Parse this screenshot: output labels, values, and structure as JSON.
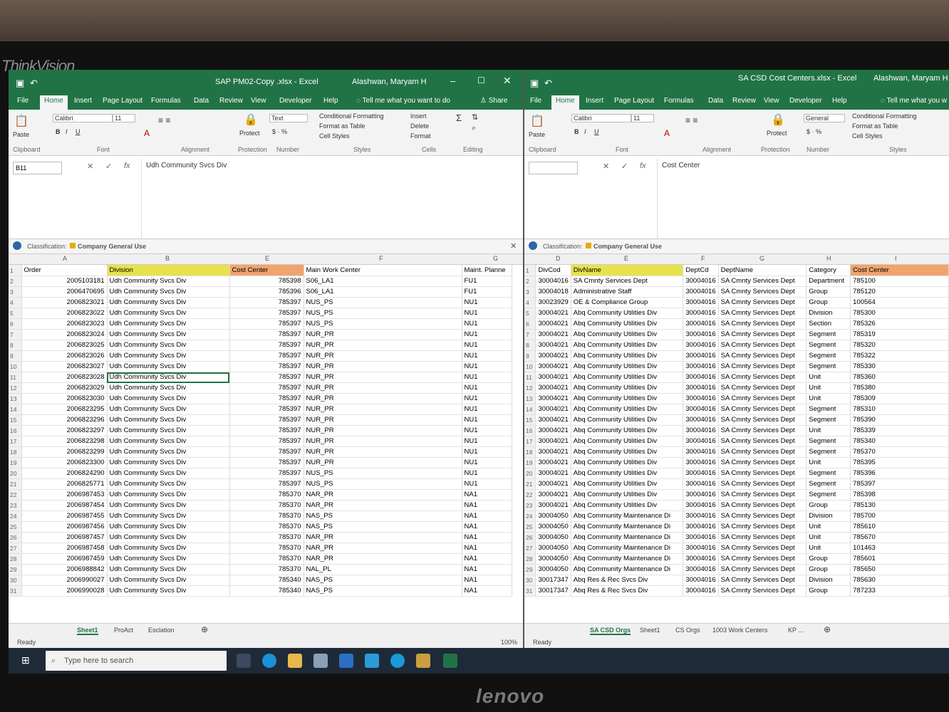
{
  "monitor": {
    "brand_top": "ThinkVision",
    "brand_bottom": "lenovo"
  },
  "left": {
    "title": "SAP PM02-Copy .xlsx - Excel",
    "user": "Alashwan, Maryam H",
    "tabs": [
      "File",
      "Home",
      "Insert",
      "Page Layout",
      "Formulas",
      "Data",
      "Review",
      "View",
      "Developer",
      "Help"
    ],
    "tell_me": "Tell me what you want to do",
    "share": "Share",
    "ribbon": {
      "font": "Calibri",
      "size": "11",
      "number_format": "Text",
      "cond_fmt": "Conditional Formatting",
      "fmt_table": "Format as Table",
      "cell_styles": "Cell Styles",
      "insert": "Insert",
      "delete": "Delete",
      "format": "Format",
      "protect": "Protect",
      "paste": "Paste",
      "groups": [
        "Clipboard",
        "Font",
        "Alignment",
        "Protection",
        "Number",
        "Styles",
        "Cells",
        "Editing"
      ]
    },
    "name_box": "B11",
    "formula": "Udh Community Svcs Div",
    "classification_label": "Classification:",
    "classification_value": "Company General Use",
    "col_letters": [
      "A",
      "B",
      "E",
      "F",
      "G"
    ],
    "headers": [
      "Order",
      "Division",
      "Cost Center",
      "Main Work Center",
      "Maint. Planne"
    ],
    "rows": [
      [
        "2005103181",
        "Udh Community Svcs Div",
        "785398",
        "S06_LA1",
        "FU1"
      ],
      [
        "2006470695",
        "Udh Community Svcs Div",
        "785396",
        "S06_LA1",
        "FU1"
      ],
      [
        "2006823021",
        "Udh Community Svcs Div",
        "785397",
        "NUS_PS",
        "NU1"
      ],
      [
        "2006823022",
        "Udh Community Svcs Div",
        "785397",
        "NUS_PS",
        "NU1"
      ],
      [
        "2006823023",
        "Udh Community Svcs Div",
        "785397",
        "NUS_PS",
        "NU1"
      ],
      [
        "2006823024",
        "Udh Community Svcs Div",
        "785397",
        "NUR_PR",
        "NU1"
      ],
      [
        "2006823025",
        "Udh Community Svcs Div",
        "785397",
        "NUR_PR",
        "NU1"
      ],
      [
        "2006823026",
        "Udh Community Svcs Div",
        "785397",
        "NUR_PR",
        "NU1"
      ],
      [
        "2006823027",
        "Udh Community Svcs Div",
        "785397",
        "NUR_PR",
        "NU1"
      ],
      [
        "2006823028",
        "Udh Community Svcs Div",
        "785397",
        "NUR_PR",
        "NU1"
      ],
      [
        "2006823029",
        "Udh Community Svcs Div",
        "785397",
        "NUR_PR",
        "NU1"
      ],
      [
        "2006823030",
        "Udh Community Svcs Div",
        "785397",
        "NUR_PR",
        "NU1"
      ],
      [
        "2006823295",
        "Udh Community Svcs Div",
        "785397",
        "NUR_PR",
        "NU1"
      ],
      [
        "2006823296",
        "Udh Community Svcs Div",
        "785397",
        "NUR_PR",
        "NU1"
      ],
      [
        "2006823297",
        "Udh Community Svcs Div",
        "785397",
        "NUR_PR",
        "NU1"
      ],
      [
        "2006823298",
        "Udh Community Svcs Div",
        "785397",
        "NUR_PR",
        "NU1"
      ],
      [
        "2006823299",
        "Udh Community Svcs Div",
        "785397",
        "NUR_PR",
        "NU1"
      ],
      [
        "2006823300",
        "Udh Community Svcs Div",
        "785397",
        "NUR_PR",
        "NU1"
      ],
      [
        "2006824290",
        "Udh Community Svcs Div",
        "785397",
        "NUS_PS",
        "NU1"
      ],
      [
        "2006825771",
        "Udh Community Svcs Div",
        "785397",
        "NUS_PS",
        "NU1"
      ],
      [
        "2006987453",
        "Udh Community Svcs Div",
        "785370",
        "NAR_PR",
        "NA1"
      ],
      [
        "2006987454",
        "Udh Community Svcs Div",
        "785370",
        "NAR_PR",
        "NA1"
      ],
      [
        "2006987455",
        "Udh Community Svcs Div",
        "785370",
        "NAS_PS",
        "NA1"
      ],
      [
        "2006987456",
        "Udh Community Svcs Div",
        "785370",
        "NAS_PS",
        "NA1"
      ],
      [
        "2006987457",
        "Udh Community Svcs Div",
        "785370",
        "NAR_PR",
        "NA1"
      ],
      [
        "2006987458",
        "Udh Community Svcs Div",
        "785370",
        "NAR_PR",
        "NA1"
      ],
      [
        "2006987459",
        "Udh Community Svcs Div",
        "785370",
        "NAR_PR",
        "NA1"
      ],
      [
        "2006988842",
        "Udh Community Svcs Div",
        "785370",
        "NAL_PL",
        "NA1"
      ],
      [
        "2006990027",
        "Udh Community Svcs Div",
        "785340",
        "NAS_PS",
        "NA1"
      ],
      [
        "2006990028",
        "Udh Community Svcs Div",
        "785340",
        "NAS_PS",
        "NA1"
      ]
    ],
    "sheet_tabs": [
      "Sheet1",
      "ProAct",
      "Esclation"
    ],
    "status": "Ready",
    "zoom": "100%"
  },
  "right": {
    "title": "SA CSD Cost Centers.xlsx - Excel",
    "user": "Alashwan, Maryam H",
    "tabs": [
      "File",
      "Home",
      "Insert",
      "Page Layout",
      "Formulas",
      "Data",
      "Review",
      "View",
      "Developer",
      "Help"
    ],
    "tell_me": "Tell me what you w",
    "ribbon": {
      "font": "Calibri",
      "size": "11",
      "number_format": "General",
      "cond_fmt": "Conditional Formatting",
      "fmt_table": "Format as Table",
      "cell_styles": "Cell Styles",
      "protect": "Protect",
      "paste": "Paste",
      "groups": [
        "Clipboard",
        "Font",
        "Alignment",
        "Protection",
        "Number",
        "Styles"
      ]
    },
    "formula": "Cost Center",
    "classification_label": "Classification:",
    "classification_value": "Company General Use",
    "col_letters": [
      "D",
      "E",
      "F",
      "G",
      "H",
      "I"
    ],
    "headers": [
      "DivCod",
      "DivName",
      "DeptCd",
      "DeptName",
      "Category",
      "Cost Center"
    ],
    "rows": [
      [
        "30004016",
        "SA Cmnty Services Dept",
        "30004016",
        "SA Cmnty Services Dept",
        "Department",
        "785100"
      ],
      [
        "30004018",
        "Administrative Staff",
        "30004016",
        "SA Cmnty Services Dept",
        "Group",
        "785120"
      ],
      [
        "30023929",
        "OE & Compliance Group",
        "30004016",
        "SA Cmnty Services Dept",
        "Group",
        "100564"
      ],
      [
        "30004021",
        "Abq Community Utilities Div",
        "30004016",
        "SA Cmnty Services Dept",
        "Division",
        "785300"
      ],
      [
        "30004021",
        "Abq Community Utilities Div",
        "30004016",
        "SA Cmnty Services Dept",
        "Section",
        "785326"
      ],
      [
        "30004021",
        "Abq Community Utilities Div",
        "30004016",
        "SA Cmnty Services Dept",
        "Segment",
        "785319"
      ],
      [
        "30004021",
        "Abq Community Utilities Div",
        "30004016",
        "SA Cmnty Services Dept",
        "Segment",
        "785320"
      ],
      [
        "30004021",
        "Abq Community Utilities Div",
        "30004016",
        "SA Cmnty Services Dept",
        "Segment",
        "785322"
      ],
      [
        "30004021",
        "Abq Community Utilities Div",
        "30004016",
        "SA Cmnty Services Dept",
        "Segment",
        "785330"
      ],
      [
        "30004021",
        "Abq Community Utilities Div",
        "30004016",
        "SA Cmnty Services Dept",
        "Unit",
        "785360"
      ],
      [
        "30004021",
        "Abq Community Utilities Div",
        "30004016",
        "SA Cmnty Services Dept",
        "Unit",
        "785380"
      ],
      [
        "30004021",
        "Abq Community Utilities Div",
        "30004016",
        "SA Cmnty Services Dept",
        "Unit",
        "785309"
      ],
      [
        "30004021",
        "Abq Community Utilities Div",
        "30004016",
        "SA Cmnty Services Dept",
        "Segment",
        "785310"
      ],
      [
        "30004021",
        "Abq Community Utilities Div",
        "30004016",
        "SA Cmnty Services Dept",
        "Segment",
        "785390"
      ],
      [
        "30004021",
        "Abq Community Utilities Div",
        "30004016",
        "SA Cmnty Services Dept",
        "Unit",
        "785339"
      ],
      [
        "30004021",
        "Abq Community Utilities Div",
        "30004016",
        "SA Cmnty Services Dept",
        "Segment",
        "785340"
      ],
      [
        "30004021",
        "Abq Community Utilities Div",
        "30004016",
        "SA Cmnty Services Dept",
        "Segment",
        "785370"
      ],
      [
        "30004021",
        "Abq Community Utilities Div",
        "30004016",
        "SA Cmnty Services Dept",
        "Unit",
        "785395"
      ],
      [
        "30004021",
        "Abq Community Utilities Div",
        "30004016",
        "SA Cmnty Services Dept",
        "Segment",
        "785396"
      ],
      [
        "30004021",
        "Abq Community Utilities Div",
        "30004016",
        "SA Cmnty Services Dept",
        "Segment",
        "785397"
      ],
      [
        "30004021",
        "Abq Community Utilities Div",
        "30004016",
        "SA Cmnty Services Dept",
        "Segment",
        "785398"
      ],
      [
        "30004021",
        "Abq Community Utilities Div",
        "30004016",
        "SA Cmnty Services Dept",
        "Group",
        "785130"
      ],
      [
        "30004050",
        "Abq Community Maintenance Di",
        "30004016",
        "SA Cmnty Services Dept",
        "Division",
        "785700"
      ],
      [
        "30004050",
        "Abq Community Maintenance Di",
        "30004016",
        "SA Cmnty Services Dept",
        "Unit",
        "785610"
      ],
      [
        "30004050",
        "Abq Community Maintenance Di",
        "30004016",
        "SA Cmnty Services Dept",
        "Unit",
        "785670"
      ],
      [
        "30004050",
        "Abq Community Maintenance Di",
        "30004016",
        "SA Cmnty Services Dept",
        "Unit",
        "101463"
      ],
      [
        "30004050",
        "Abq Community Maintenance Di",
        "30004016",
        "SA Cmnty Services Dept",
        "Group",
        "785601"
      ],
      [
        "30004050",
        "Abq Community Maintenance Di",
        "30004016",
        "SA Cmnty Services Dept",
        "Group",
        "785650"
      ],
      [
        "30017347",
        "Abq Res & Rec Svcs Div",
        "30004016",
        "SA Cmnty Services Dept",
        "Division",
        "785630"
      ],
      [
        "30017347",
        "Abq Res & Rec Svcs Div",
        "30004016",
        "SA Cmnty Services Dept",
        "Group",
        "787233"
      ]
    ],
    "sheet_tabs": [
      "SA CSD Orgs",
      "Sheet1",
      "CS Orgs",
      "1003 Work Centers",
      "KP ..."
    ],
    "status": "Ready"
  },
  "taskbar": {
    "search_placeholder": "Type here to search"
  },
  "colors": {
    "excel_green": "#217346",
    "header_yellow": "#e8e24a",
    "header_orange": "#f0a46c"
  }
}
